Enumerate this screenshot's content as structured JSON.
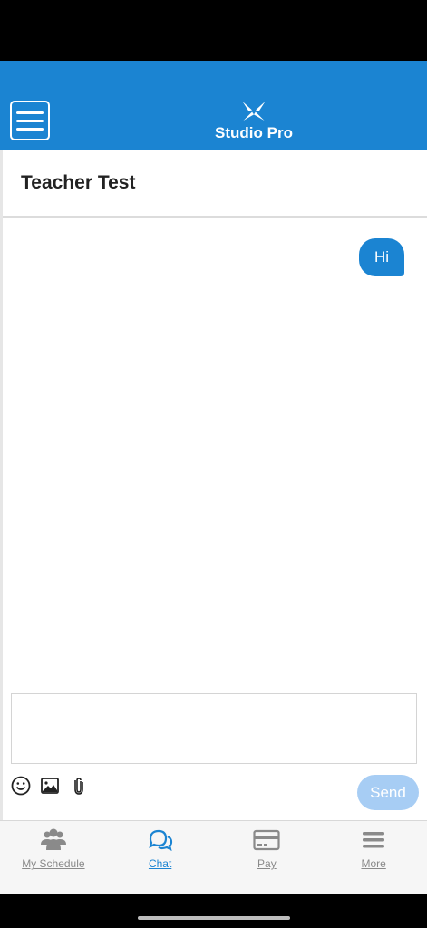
{
  "app": {
    "brand_name": "Studio Pro",
    "accent_color": "#1b84d2"
  },
  "header": {
    "menu_icon": "hamburger-icon",
    "logo_icon": "studio-pro-logo"
  },
  "conversation": {
    "title": "Teacher Test",
    "messages": [
      {
        "text": "Hi",
        "direction": "outgoing"
      }
    ]
  },
  "composer": {
    "placeholder": "",
    "value": "",
    "tools": [
      "emoji-icon",
      "image-icon",
      "attachment-icon"
    ],
    "send_label": "Send"
  },
  "tabs": [
    {
      "label": "My Schedule",
      "icon": "users-icon",
      "active": false
    },
    {
      "label": "Chat",
      "icon": "chat-icon",
      "active": true
    },
    {
      "label": "Pay",
      "icon": "credit-card-icon",
      "active": false
    },
    {
      "label": "More",
      "icon": "menu-lines-icon",
      "active": false
    }
  ]
}
